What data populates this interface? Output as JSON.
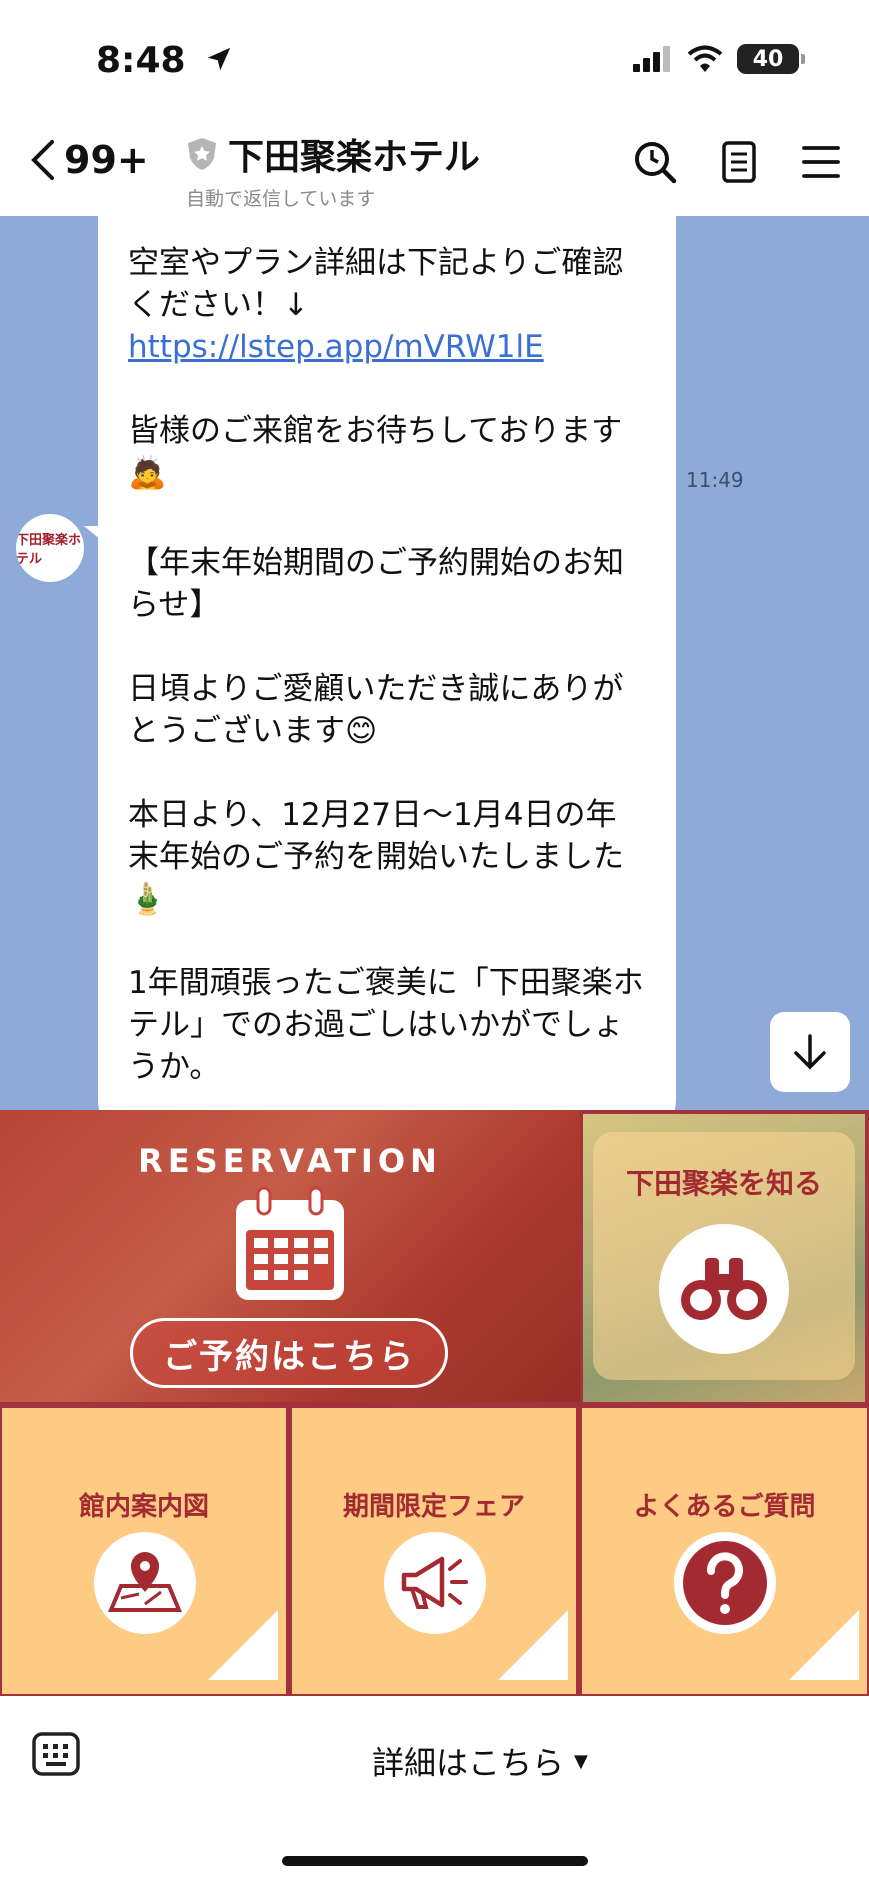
{
  "status_bar": {
    "time": "8:48",
    "battery": "40"
  },
  "header": {
    "back_count": "99+",
    "title": "下田聚楽ホテル",
    "subtitle": "自動で返信しています"
  },
  "chat": {
    "message_1": {
      "line_1": "空室やプラン詳細は下記よりご確認ください！↓",
      "link": "https://lstep.app/mVRW1lE",
      "line_2": "皆様のご来館をお待ちしております🙇"
    },
    "message_1_time": "11:49",
    "message_2": {
      "para_1": "【年末年始期間のご予約開始のお知らせ】",
      "para_2": "日頃よりご愛顧いただき誠にありがとうございます😊",
      "para_3": "本日より、12月27日～1月4日の年末年始のご予約を開始いたしました🎍",
      "para_4": "1年間頑張ったご褒美に「下田聚楽ホテル」でのお過ごしはいかがでしょうか。"
    },
    "avatar_text": "下田聚楽ホテル"
  },
  "rich_menu": {
    "reservation_title": "RESERVATION",
    "reservation_button": "ご予約はこちら",
    "know_label": "下田聚楽を知る",
    "map_label": "館内案内図",
    "fair_label": "期間限定フェア",
    "faq_label": "よくあるご質問"
  },
  "bottom_bar": {
    "label": "詳細はこちら"
  },
  "colors": {
    "chat_bg": "#8daad8",
    "menu_red": "#a42a32",
    "tile_orange": "#fdcb84",
    "link": "#3b6fd6"
  }
}
